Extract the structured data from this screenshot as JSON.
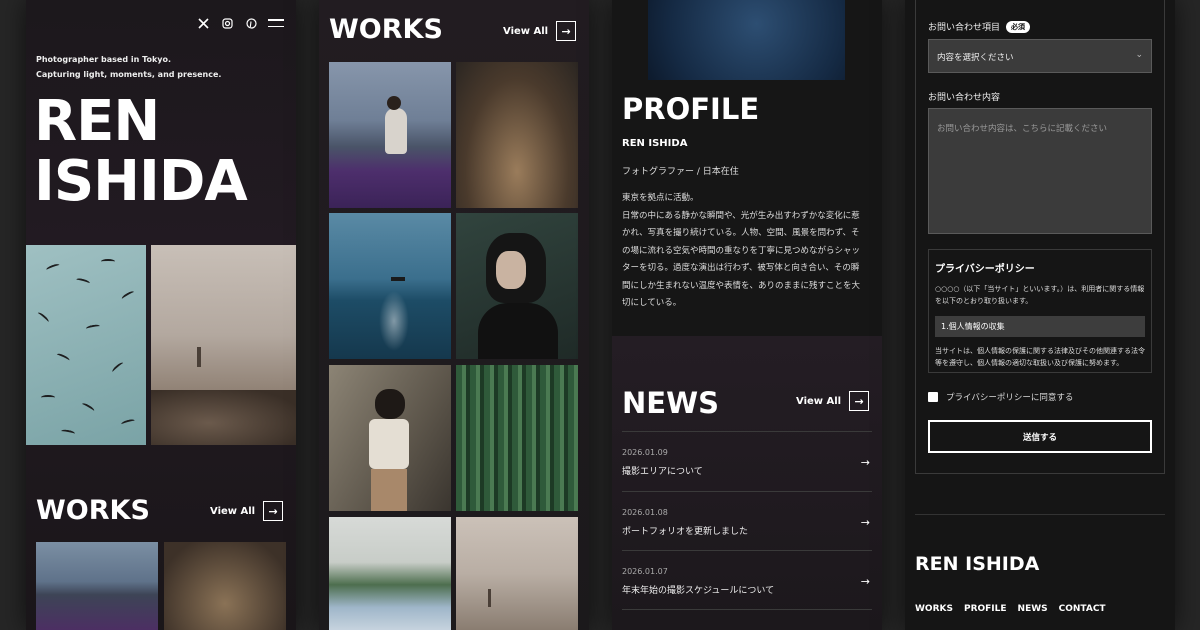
{
  "header": {
    "icons": [
      "x-icon",
      "instagram-icon",
      "pinterest-icon",
      "menu-icon"
    ],
    "tagline_line1": "Photographer based in Tokyo.",
    "tagline_line2": "Capturing light, moments, and presence.",
    "name_line1": "REN",
    "name_line2": "ISHIDA"
  },
  "works": {
    "title": "WORKS",
    "view_all": "View All"
  },
  "profile": {
    "title": "PROFILE",
    "name": "REN ISHIDA",
    "role": "フォトグラファー / 日本在住",
    "bio_lines": [
      "東京を拠点に活動。",
      "日常の中にある静かな瞬間や、光が生み出すわずかな変化に惹",
      "かれ、写真を撮り続けている。人物、空間、風景を問わず、そ",
      "の場に流れる空気や時間の重なりを丁寧に見つめながらシャッ",
      "ターを切る。過度な演出は行わず、被写体と向き合い、その瞬",
      "間にしか生まれない温度や表情を、ありのままに残すことを大",
      "切にしている。"
    ]
  },
  "news": {
    "title": "NEWS",
    "view_all": "View All",
    "items": [
      {
        "date": "2026.01.09",
        "text": "撮影エリアについて"
      },
      {
        "date": "2026.01.08",
        "text": "ポートフォリオを更新しました"
      },
      {
        "date": "2026.01.07",
        "text": "年末年始の撮影スケジュールについて"
      }
    ]
  },
  "contact": {
    "category_label": "お問い合わせ項目",
    "required_badge": "必須",
    "select_value": "内容を選択ください",
    "message_label": "お問い合わせ内容",
    "message_placeholder": "お問い合わせ内容は、こちらに記載ください",
    "privacy_title": "プライバシーポリシー",
    "privacy_intro": "○○○○（以下「当サイト」といいます。）は、利用者に関する情報を以下のとおり取り扱います。",
    "privacy_section": "1.個人情報の収集",
    "privacy_body": "当サイトは、個人情報の保護に関する法律及びその他関連する法令等を遵守し、個人情報の適切な取扱い及び保護に努めます。",
    "agree_label": "プライバシーポリシーに同意する",
    "submit_label": "送信する"
  },
  "footer": {
    "name": "REN ISHIDA",
    "nav": [
      "WORKS",
      "PROFILE",
      "NEWS",
      "CONTACT"
    ]
  }
}
